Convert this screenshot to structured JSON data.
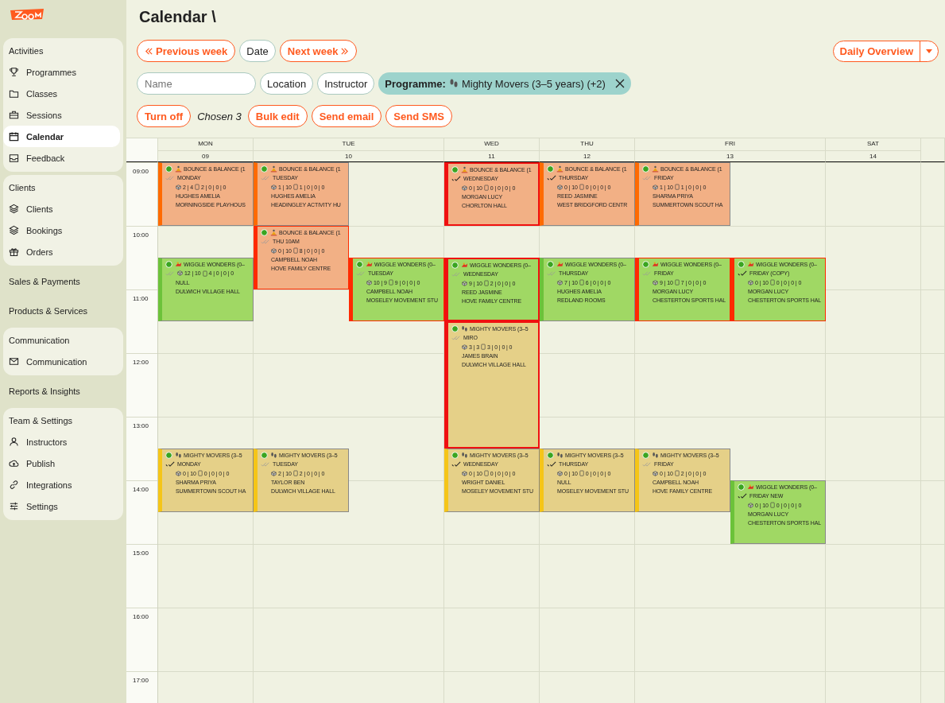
{
  "sidebar": {
    "groups": [
      {
        "title": "Activities",
        "card": true,
        "items": [
          {
            "label": "Programmes",
            "selected": false
          },
          {
            "label": "Classes",
            "selected": false
          },
          {
            "label": "Sessions",
            "selected": false
          },
          {
            "label": "Calendar",
            "selected": true
          },
          {
            "label": "Feedback",
            "selected": false
          }
        ]
      },
      {
        "title": "Clients",
        "card": true,
        "items": [
          {
            "label": "Clients",
            "selected": false
          },
          {
            "label": "Bookings",
            "selected": false
          },
          {
            "label": "Orders",
            "selected": false
          }
        ]
      },
      {
        "title": "Sales & Payments",
        "card": false
      },
      {
        "title": "Products & Services",
        "card": false
      },
      {
        "title": "Communication",
        "card": true,
        "items": [
          {
            "label": "Communication",
            "selected": false
          }
        ]
      },
      {
        "title": "Reports & Insights",
        "card": false
      },
      {
        "title": "Team & Settings",
        "card": true,
        "items": [
          {
            "label": "Instructors",
            "selected": false
          },
          {
            "label": "Publish",
            "selected": false
          },
          {
            "label": "Integrations",
            "selected": false
          },
          {
            "label": "Settings",
            "selected": false
          }
        ]
      }
    ]
  },
  "title": "Calendar \\",
  "nav": {
    "previous": "Previous week",
    "date": "Date",
    "next": "Next week",
    "overview": "Daily Overview"
  },
  "filters": {
    "name_placeholder": "Name",
    "location": "Location",
    "instructor": "Instructor",
    "chip_label": "Programme:",
    "chip_value": "Mighty Movers (3–5 years) (+2)"
  },
  "actions": {
    "turn_off": "Turn off",
    "chosen": "Chosen 3",
    "bulk_edit": "Bulk edit",
    "send_email": "Send email",
    "send_sms": "Send SMS"
  },
  "times": [
    "09:00",
    "10:00",
    "11:00",
    "12:00",
    "13:00",
    "14:00",
    "15:00",
    "16:00",
    "17:00"
  ],
  "days": [
    {
      "name": "MON",
      "date": "09",
      "events": [
        {
          "kind": "bounce",
          "title": "BOUNCE & BALANCE (1",
          "day_label": "MONDAY",
          "spaces": "2 | 4",
          "bookings": "2 | 0 | 0 | 0",
          "instructor": "HUGHES AMELIA",
          "venue": "MORNINGSIDE PLAYHOUS",
          "confirmed": false,
          "selected": false,
          "conflict": false
        },
        {
          "kind": "wiggle",
          "title": "WIGGLE WONDERS (0–",
          "spaces": "12 | 10",
          "bookings": "4 | 0 | 0 | 0",
          "instructor": "NULL",
          "venue": "DULWICH VILLAGE HALL",
          "confirmed": false,
          "selected": false,
          "conflict": false
        },
        {
          "kind": "mighty",
          "title": "MIGHTY MOVERS (3–5",
          "day_label": "MONDAY",
          "spaces": "0 | 10",
          "bookings": "0 | 0 | 0 | 0",
          "instructor": "SHARMA PRIYA",
          "venue": "SUMMERTOWN SCOUT HA",
          "confirmed": true,
          "selected": false,
          "conflict": false
        }
      ]
    },
    {
      "name": "TUE",
      "date": "10",
      "events": [
        {
          "kind": "bounce",
          "title": "BOUNCE & BALANCE (1",
          "day_label": "TUESDAY",
          "spaces": "1 | 10",
          "bookings": "1 | 0 | 0 | 0",
          "instructor": "HUGHES AMELIA",
          "venue": "HEADINGLEY ACTIVITY HU",
          "confirmed": false,
          "selected": false,
          "conflict": false
        },
        {
          "kind": "bounce",
          "title": "BOUNCE & BALANCE (1",
          "day_label": "THU 10AM",
          "spaces": "0 | 10",
          "bookings": "8 | 0 | 0 | 0",
          "instructor": "CAMPBELL NOAH",
          "venue": "HOVE FAMILY CENTRE",
          "confirmed": false,
          "selected": false,
          "conflict": true
        },
        {
          "kind": "wiggle",
          "title": "WIGGLE WONDERS (0–",
          "day_label": "TUESDAY",
          "spaces": "10 | 9",
          "bookings": "9 | 0 | 0 | 0",
          "instructor": "CAMPBELL NOAH",
          "venue": "MOSELEY MOVEMENT STU",
          "confirmed": false,
          "selected": false,
          "conflict": true
        },
        {
          "kind": "mighty",
          "title": "MIGHTY MOVERS (3–5",
          "day_label": "TUESDAY",
          "spaces": "2 | 10",
          "bookings": "2 | 0 | 0 | 0",
          "instructor": "TAYLOR BEN",
          "venue": "DULWICH VILLAGE HALL",
          "confirmed": false,
          "selected": false,
          "conflict": false
        }
      ]
    },
    {
      "name": "WED",
      "date": "11",
      "events": [
        {
          "kind": "bounce",
          "title": "BOUNCE & BALANCE (1",
          "day_label": "WEDNESDAY",
          "spaces": "0 | 10",
          "bookings": "0 | 0 | 0 | 0",
          "instructor": "MORGAN LUCY",
          "venue": "CHORLTON HALL",
          "confirmed": true,
          "selected": true,
          "conflict": false
        },
        {
          "kind": "wiggle",
          "title": "WIGGLE WONDERS (0–",
          "day_label": "WEDNESDAY",
          "spaces": "9 | 10",
          "bookings": "2 | 0 | 0 | 0",
          "instructor": "REED JASMINE",
          "venue": "HOVE FAMILY CENTRE",
          "confirmed": false,
          "selected": true,
          "conflict": false
        },
        {
          "kind": "mighty",
          "title": "MIGHTY MOVERS (3–5",
          "day_label": "MIRO",
          "spaces": "3 | 3",
          "bookings": "3 | 0 | 0 | 0",
          "instructor": "JAMES BRAIN",
          "venue": "DULWICH VILLAGE HALL",
          "confirmed": false,
          "selected": true,
          "conflict": false
        },
        {
          "kind": "mighty",
          "title": "MIGHTY MOVERS (3–5",
          "day_label": "WEDNESDAY",
          "spaces": "0 | 10",
          "bookings": "0 | 0 | 0 | 0",
          "instructor": "WRIGHT DANIEL",
          "venue": "MOSELEY MOVEMENT STU",
          "confirmed": true,
          "selected": false,
          "conflict": false
        }
      ]
    },
    {
      "name": "THU",
      "date": "12",
      "events": [
        {
          "kind": "bounce",
          "title": "BOUNCE & BALANCE (1",
          "day_label": "THURSDAY",
          "spaces": "0 | 10",
          "bookings": "0 | 0 | 0 | 0",
          "instructor": "REED JASMINE",
          "venue": "WEST BRIDGFORD CENTR",
          "confirmed": true,
          "selected": false,
          "conflict": false
        },
        {
          "kind": "wiggle",
          "title": "WIGGLE WONDERS (0–",
          "day_label": "THURSDAY",
          "spaces": "7 | 10",
          "bookings": "6 | 0 | 0 | 0",
          "instructor": "HUGHES AMELIA",
          "venue": "REDLAND ROOMS",
          "confirmed": false,
          "selected": false,
          "conflict": false
        },
        {
          "kind": "mighty",
          "title": "MIGHTY MOVERS (3–5",
          "day_label": "THURSDAY",
          "spaces": "0 | 10",
          "bookings": "0 | 0 | 0 | 0",
          "instructor": "NULL",
          "venue": "MOSELEY MOVEMENT STU",
          "confirmed": true,
          "selected": false,
          "conflict": false
        }
      ]
    },
    {
      "name": "FRI",
      "date": "13",
      "events": [
        {
          "kind": "bounce",
          "title": "BOUNCE & BALANCE (1",
          "day_label": "FRIDAY",
          "spaces": "1 | 10",
          "bookings": "1 | 0 | 0 | 0",
          "instructor": "SHARMA PRIYA",
          "venue": "SUMMERTOWN SCOUT HA",
          "confirmed": false,
          "selected": false,
          "conflict": false
        },
        {
          "kind": "wiggle",
          "title": "WIGGLE WONDERS (0–",
          "day_label": "FRIDAY",
          "spaces": "9 | 10",
          "bookings": "7 | 0 | 0 | 0",
          "instructor": "MORGAN LUCY",
          "venue": "CHESTERTON SPORTS HAL",
          "confirmed": false,
          "selected": false,
          "conflict": true
        },
        {
          "kind": "wiggle",
          "title": "WIGGLE WONDERS (0–",
          "day_label": "FRIDAY (COPY)",
          "spaces": "0 | 10",
          "bookings": "0 | 0 | 0 | 0",
          "instructor": "MORGAN LUCY",
          "venue": "CHESTERTON SPORTS HAL",
          "confirmed": true,
          "selected": false,
          "conflict": true
        },
        {
          "kind": "mighty",
          "title": "MIGHTY MOVERS (3–5",
          "day_label": "FRIDAY",
          "spaces": "0 | 10",
          "bookings": "2 | 0 | 0 | 0",
          "instructor": "CAMPBELL NOAH",
          "venue": "HOVE FAMILY CENTRE",
          "confirmed": false,
          "selected": false,
          "conflict": false
        },
        {
          "kind": "wiggle",
          "title": "WIGGLE WONDERS (0–",
          "day_label": "FRIDAY NEW",
          "spaces": "0 | 10",
          "bookings": "0 | 0 | 0 | 0",
          "instructor": "MORGAN LUCY",
          "venue": "CHESTERTON SPORTS HAL",
          "confirmed": true,
          "selected": false,
          "conflict": false
        }
      ]
    },
    {
      "name": "SAT",
      "date": "14"
    }
  ]
}
